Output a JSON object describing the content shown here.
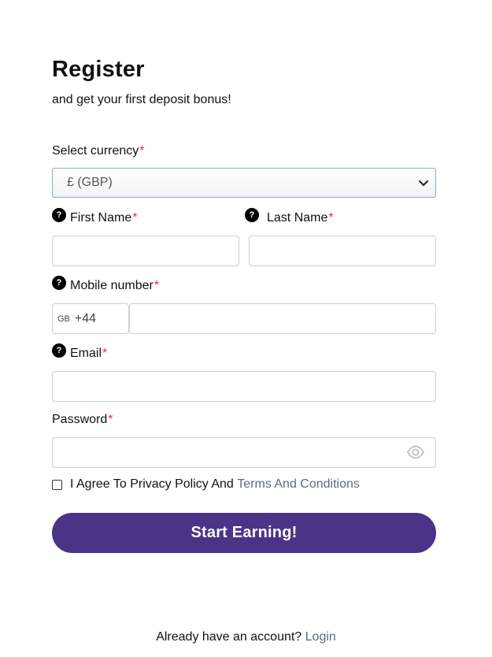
{
  "header": {
    "title": "Register",
    "subtitle": "and get your first deposit bonus!"
  },
  "currency": {
    "label": "Select currency",
    "required_mark": "*",
    "selected": "£ (GBP)"
  },
  "first_name": {
    "label": "First Name",
    "required_mark": "*",
    "help_icon": "?",
    "value": ""
  },
  "last_name": {
    "label": "Last Name",
    "required_mark": "*",
    "help_icon": "?",
    "value": ""
  },
  "mobile": {
    "label": "Mobile number",
    "required_mark": "*",
    "help_icon": "?",
    "country_code": "GB",
    "dial_code": "+44",
    "value": ""
  },
  "email": {
    "label": "Email",
    "required_mark": "*",
    "help_icon": "?",
    "value": ""
  },
  "password": {
    "label": "Password",
    "required_mark": "*",
    "value": ""
  },
  "agree": {
    "text": "I Agree To Privacy Policy And",
    "link": "Terms And Conditions"
  },
  "submit": {
    "label": "Start Earning!"
  },
  "footer": {
    "text": "Already have an account?",
    "link": "Login"
  },
  "colors": {
    "accent": "#4b3488",
    "required": "#d9304f",
    "link": "#5a6b85"
  }
}
